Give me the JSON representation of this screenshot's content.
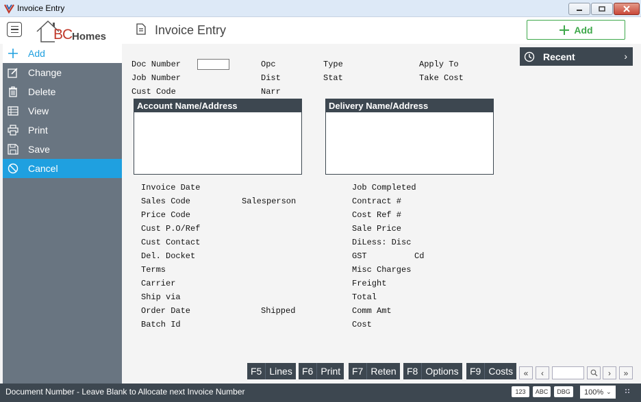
{
  "window": {
    "title": "Invoice Entry"
  },
  "header": {
    "page_title": "Invoice Entry",
    "add_label": "Add",
    "logo_bc": "BC",
    "logo_homes": "Homes"
  },
  "sidebar": {
    "items": [
      {
        "label": "Add",
        "icon": "plus-icon"
      },
      {
        "label": "Change",
        "icon": "edit-icon"
      },
      {
        "label": "Delete",
        "icon": "trash-icon"
      },
      {
        "label": "View",
        "icon": "table-icon"
      },
      {
        "label": "Print",
        "icon": "printer-icon"
      },
      {
        "label": "Save",
        "icon": "save-icon"
      },
      {
        "label": "Cancel",
        "icon": "cancel-icon"
      }
    ]
  },
  "recent": {
    "label": "Recent"
  },
  "form": {
    "doc_number": "Doc Number",
    "job_number": "Job Number",
    "cust_code": "Cust Code",
    "opc": "Opc",
    "dist": "Dist",
    "narr": "Narr",
    "type": "Type",
    "stat": "Stat",
    "apply_to": "Apply To",
    "take_cost": "Take Cost",
    "account_panel": "Account Name/Address",
    "delivery_panel": "Delivery Name/Address",
    "left_labels": [
      "Invoice Date",
      "Sales Code",
      "Price Code",
      "Cust P.O/Ref",
      "Cust Contact",
      "Del. Docket",
      "Terms",
      "Carrier",
      "Ship via",
      "Order Date",
      "Batch Id"
    ],
    "salesperson": "Salesperson",
    "shipped": "Shipped",
    "right_labels": [
      "Job Completed",
      "Contract #",
      "Cost Ref #",
      "Sale Price",
      "DiLess: Disc",
      "GST",
      "Misc Charges",
      "Freight",
      "Total",
      "Comm Amt",
      "Cost"
    ],
    "cd": "Cd"
  },
  "fkeys": [
    {
      "key": "F5",
      "label": "Lines"
    },
    {
      "key": "F6",
      "label": "Print"
    },
    {
      "key": "F7",
      "label": "Reten"
    },
    {
      "key": "F8",
      "label": "Options"
    },
    {
      "key": "F9",
      "label": "Costs"
    }
  ],
  "status": {
    "message": "Document Number - Leave Blank to Allocate next Invoice Number",
    "chip_123": "123",
    "chip_abc": "ABC",
    "chip_dbg": "DBG",
    "zoom": "100%"
  },
  "colors": {
    "accent": "#1fa0e0",
    "sidebar": "#697581",
    "dark": "#3d4750",
    "green": "#3ea84a",
    "logo_red": "#c0392b"
  }
}
